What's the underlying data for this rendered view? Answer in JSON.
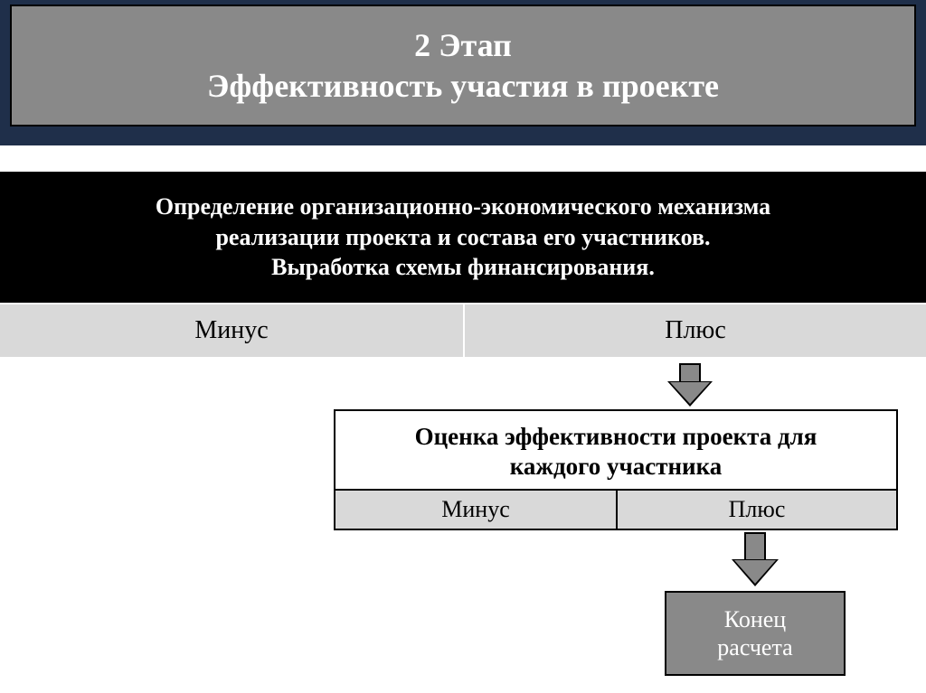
{
  "title": {
    "line1": "2 Этап",
    "line2": "Эффективность участия в проекте"
  },
  "description": {
    "line1": "Определение организационно-экономического механизма",
    "line2": "реализации проекта и состава его участников.",
    "line3": "Выработка схемы финансирования."
  },
  "row1": {
    "left": "Минус",
    "right": "Плюс"
  },
  "eval": {
    "title_line1": "Оценка  эффективности проекта для",
    "title_line2": "каждого участника",
    "left": "Минус",
    "right": "Плюс"
  },
  "end": {
    "line1": "Конец",
    "line2": "расчета"
  },
  "colors": {
    "banner_gray": "#898989",
    "panel_gray": "#d9d9d9",
    "top_band": "#1f2f4a"
  }
}
